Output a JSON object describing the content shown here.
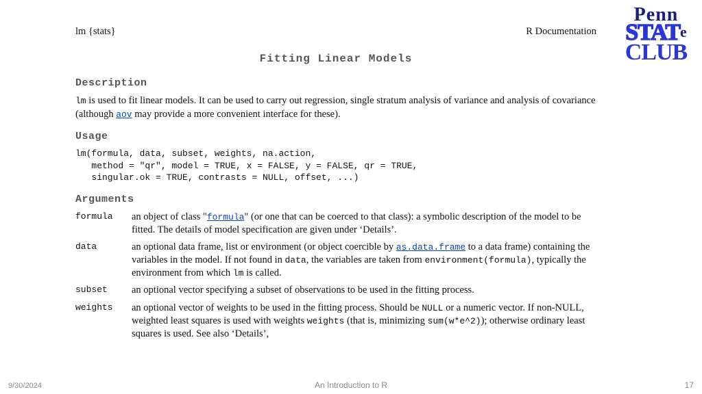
{
  "header": {
    "left": "lm {stats}",
    "right": "R Documentation",
    "title": "Fitting Linear Models"
  },
  "sections": {
    "description_h": "Description",
    "desc_p1a": "lm",
    "desc_p1b": " is used to fit linear models. It can be used to carry out regression, single stratum analysis of variance and analysis of covariance (although ",
    "desc_link": "aov",
    "desc_p1c": " may provide a more convenient interface for these).",
    "usage_h": "Usage",
    "usage_code": "lm(formula, data, subset, weights, na.action,\n   method = \"qr\", model = TRUE, x = FALSE, y = FALSE, qr = TRUE,\n   singular.ok = TRUE, contrasts = NULL, offset, ...)",
    "arguments_h": "Arguments"
  },
  "args": {
    "formula": {
      "name": "formula",
      "d1": "an object of class \"",
      "link": "formula",
      "d2": "\" (or one that can be coerced to that class): a symbolic description of the model to be fitted. The details of model specification are given under ‘Details’."
    },
    "data": {
      "name": "data",
      "d1": "an optional data frame, list or environment (or object coercible by ",
      "link": "as.data.frame",
      "d2": " to a data frame) containing the variables in the model. If not found in ",
      "m1": "data",
      "d3": ", the variables are taken from ",
      "m2": "environment(formula)",
      "d4": ", typically the environment from which ",
      "m3": "lm",
      "d5": " is called."
    },
    "subset": {
      "name": "subset",
      "d": "an optional vector specifying a subset of observations to be used in the fitting process."
    },
    "weights": {
      "name": "weights",
      "d1": "an optional vector of weights to be used in the fitting process. Should be ",
      "m1": "NULL",
      "d2": " or a numeric vector. If non-NULL, weighted least squares is used with weights ",
      "m2": "weights",
      "d3": " (that is, minimizing ",
      "m3": "sum(w*e^2)",
      "d4": "); otherwise ordinary least squares is used. See also ‘Details’,"
    }
  },
  "logo": {
    "l1": "Penn",
    "l2big": "STAT",
    "l2sm": "e",
    "l3": "CLUB"
  },
  "footer": {
    "date": "9/30/2024",
    "title": "An Introduction to R",
    "page": "17"
  }
}
